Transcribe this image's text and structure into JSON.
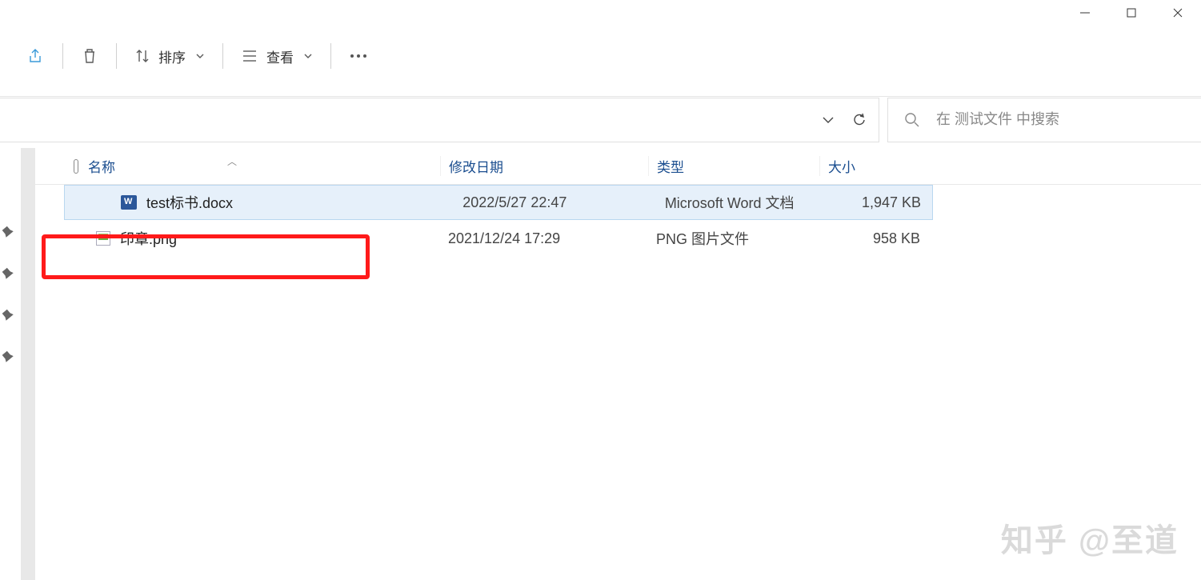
{
  "window": {
    "minimize": "—",
    "maximize": "▢",
    "close": "✕"
  },
  "toolbar": {
    "sort_label": "排序",
    "view_label": "查看"
  },
  "search": {
    "placeholder": "在 测试文件 中搜索"
  },
  "columns": {
    "name": "名称",
    "modified": "修改日期",
    "type": "类型",
    "size": "大小"
  },
  "files": [
    {
      "name": "test标书.docx",
      "modified": "2022/5/27 22:47",
      "type": "Microsoft Word 文档",
      "size": "1,947 KB",
      "icon": "docx",
      "selected": true
    },
    {
      "name": "印章.png",
      "modified": "2021/12/24 17:29",
      "type": "PNG 图片文件",
      "size": "958 KB",
      "icon": "png",
      "selected": false
    }
  ],
  "watermark": "知乎 @至道"
}
